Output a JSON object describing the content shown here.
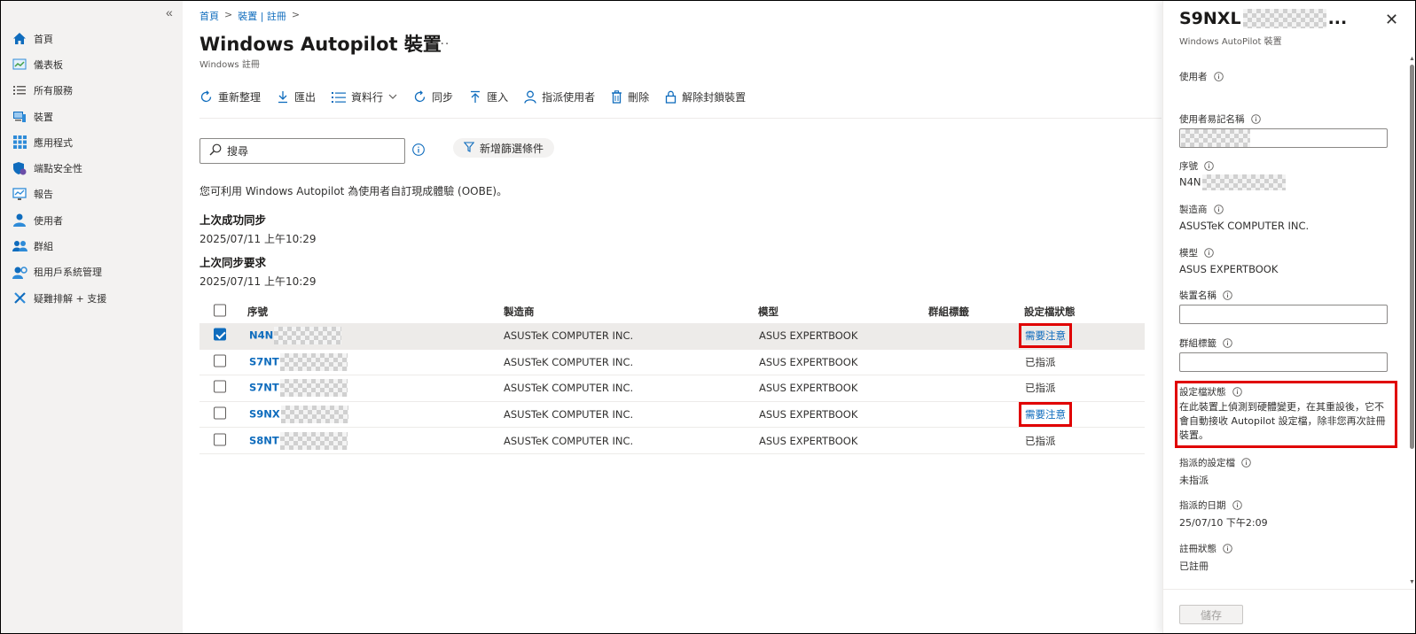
{
  "sidebar": {
    "collapse_label": "«",
    "items": [
      {
        "label": "首頁",
        "icon": "home-icon"
      },
      {
        "label": "儀表板",
        "icon": "dashboard-icon"
      },
      {
        "label": "所有服務",
        "icon": "list-icon"
      },
      {
        "label": "裝置",
        "icon": "device-icon"
      },
      {
        "label": "應用程式",
        "icon": "apps-grid-icon"
      },
      {
        "label": "端點安全性",
        "icon": "shield-icon"
      },
      {
        "label": "報告",
        "icon": "report-icon"
      },
      {
        "label": "使用者",
        "icon": "user-icon"
      },
      {
        "label": "群組",
        "icon": "group-icon"
      },
      {
        "label": "租用戶系統管理",
        "icon": "tenant-admin-icon"
      },
      {
        "label": "疑難排解 + 支援",
        "icon": "troubleshoot-icon"
      }
    ]
  },
  "breadcrumb": {
    "home": "首頁",
    "devices": "裝置 | 註冊",
    "sep": ">"
  },
  "page": {
    "title": "Windows Autopilot 裝置",
    "more": "...",
    "subtitle": "Windows 註冊"
  },
  "toolbar": {
    "refresh": "重新整理",
    "export": "匯出",
    "columns": "資料行",
    "sync": "同步",
    "import": "匯入",
    "assign_user": "指派使用者",
    "delete": "刪除",
    "unblock": "解除封鎖裝置"
  },
  "search": {
    "placeholder": "搜尋"
  },
  "filter": {
    "label": "新增篩選條件"
  },
  "info": {
    "text": "您可利用 Windows Autopilot 為使用者自訂現成體驗 (OOBE)。",
    "last_success_heading": "上次成功同步",
    "last_success_value": "2025/07/11 上午10:29",
    "last_request_heading": "上次同步要求",
    "last_request_value": "2025/07/11 上午10:29"
  },
  "table": {
    "columns": {
      "serial": "序號",
      "manufacturer": "製造商",
      "model": "模型",
      "group_tag": "群組標籤",
      "profile_status": "設定檔狀態"
    },
    "rows": [
      {
        "serial": "N4N",
        "manufacturer": "ASUSTeK COMPUTER INC.",
        "model": "ASUS EXPERTBOOK",
        "group_tag": "",
        "status": "需要注意"
      },
      {
        "serial": "S7NT",
        "manufacturer": "ASUSTeK COMPUTER INC.",
        "model": "ASUS EXPERTBOOK",
        "group_tag": "",
        "status": "已指派"
      },
      {
        "serial": "S7NT",
        "manufacturer": "ASUSTeK COMPUTER INC.",
        "model": "ASUS EXPERTBOOK",
        "group_tag": "",
        "status": "已指派"
      },
      {
        "serial": "S9NX",
        "manufacturer": "ASUSTeK COMPUTER INC.",
        "model": "ASUS EXPERTBOOK",
        "group_tag": "",
        "status": "需要注意"
      },
      {
        "serial": "S8NT",
        "manufacturer": "ASUSTeK COMPUTER INC.",
        "model": "ASUS EXPERTBOOK",
        "group_tag": "",
        "status": "已指派"
      }
    ]
  },
  "panel": {
    "title_prefix": "S9NXL",
    "title_suffix": "...",
    "subtitle": "Windows AutoPilot 裝置",
    "close": "✕",
    "user_label": "使用者",
    "friendly_name_label": "使用者易記名稱",
    "serial_label": "序號",
    "serial_value": "N4N",
    "manufacturer_label": "製造商",
    "manufacturer_value": "ASUSTeK COMPUTER INC.",
    "model_label": "模型",
    "model_value": "ASUS EXPERTBOOK",
    "device_name_label": "裝置名稱",
    "group_tag_label": "群組標籤",
    "profile_status_label": "設定檔狀態",
    "profile_status_desc": "在此裝置上偵測到硬體變更，在其重設後，它不會自動接收 Autopilot 設定檔，除非您再次註冊裝置。",
    "assigned_profile_label": "指派的設定檔",
    "assigned_profile_value": "未指派",
    "assigned_date_label": "指派的日期",
    "assigned_date_value": "25/07/10 下午2:09",
    "enrollment_status_label": "註冊狀態",
    "enrollment_status_value": "已註冊",
    "save": "儲存"
  },
  "colors": {
    "accent": "#0f6cbd",
    "highlight": "#e00000"
  }
}
